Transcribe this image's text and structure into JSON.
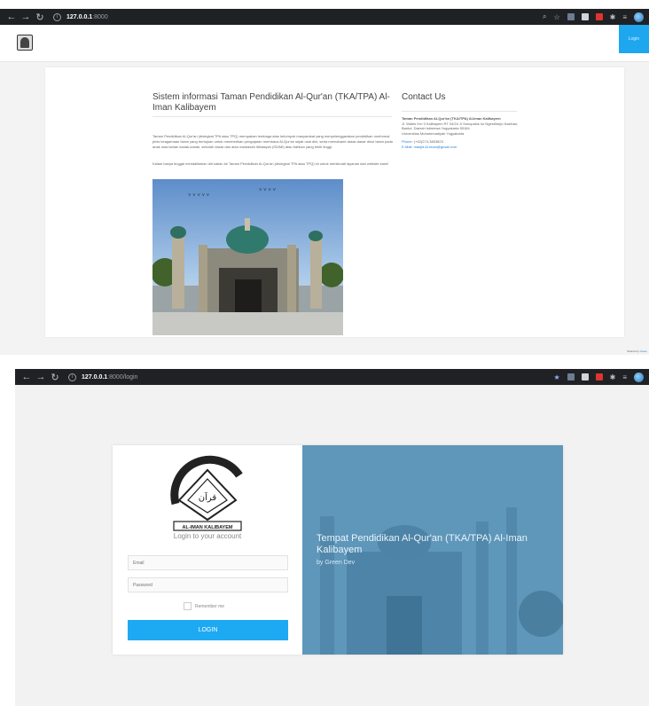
{
  "home": {
    "browser": {
      "url_host": "127.0.0.1",
      "url_path": ":8000"
    },
    "header": {
      "login_label": "Login"
    },
    "heading": "Sistem informasi Taman Pendidikan Al-Qur'an (TKA/TPA) Al-Iman Kalibayem",
    "paragraph1": "Taman Pendidikan Al-Qur'an (disingkat TPA atau TPQ) merupakan lembaga atau kelompok masyarakat yang menyelenggarakan pendidikan nonformal jenis keagamaan Islam yang bertujuan untuk memberikan pengajaran membaca Al-Qur'an sejak usia dini, serta memahami dasar-dasar dinul Islam pada anak usia taman kanak-kanak, sekolah dasar dan atau madrasah ibtidaiyah (SD/MI) atau bahkan yang lebih tinggi.",
    "paragraph2": "Kalian hanya tinggal mendaftarkan diri kalian ke Taman Pendidikan Al-Qur'an (disingkat TPA atau TPQ) ini untuk menikmati layanan dari website kami!",
    "contact": {
      "title": "Contact Us",
      "org": "Taman Pendidikan Al-Qur'an (TKA/TPA) Al-Iman Kalibayem",
      "address": "Jl. Wates Km 3 Kalibayem RT 04/24 Ji Sonopakis lor Ngestiharjo Kasihan, Bantul, Daerah Istimewa Yogyakarta 55184",
      "university": "Universitas Muhammadiyah Yogyakarta",
      "phone_label": "Phone:",
      "phone": "(+62)274-3803823",
      "email_label": "E-Mail:",
      "email": "masjid.Al.Iman@gmail.com"
    },
    "credit_prefix": "Shared by",
    "credit_name": "Green"
  },
  "login": {
    "browser": {
      "url_host": "127.0.0.1",
      "url_path": ":8000/login"
    },
    "seal_text": "AL-IMAN KALIBAYEM",
    "subtitle": "Login to your account",
    "email_placeholder": "Email",
    "password_placeholder": "Password",
    "remember_label": "Remember me",
    "button_label": "LOGIN",
    "hero_title": "Tempat Pendidikan Al-Qur'an (TKA/TPA) Al-Iman Kalibayem",
    "hero_sub": "by Green Dev"
  },
  "colors": {
    "accent": "#1ea9f3",
    "hero_overlay": "#5a93b6",
    "chrome": "#202124"
  }
}
